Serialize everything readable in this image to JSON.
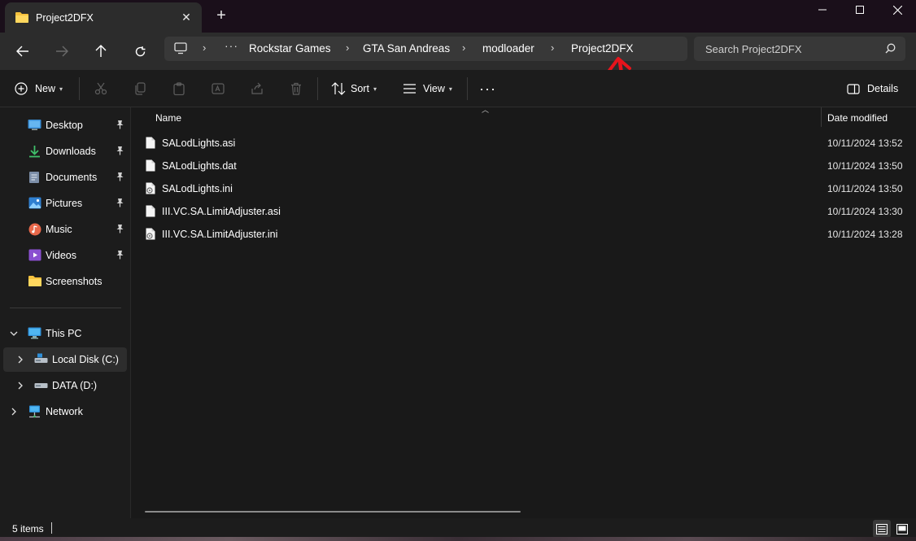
{
  "window": {
    "tab_title": "Project2DFX",
    "new_tab_symbol": "+"
  },
  "address": {
    "breadcrumbs": [
      "Rockstar Games",
      "GTA San Andreas",
      "modloader",
      "Project2DFX"
    ],
    "overflow": "···",
    "search_placeholder": "Search Project2DFX"
  },
  "toolbar": {
    "new_label": "New",
    "sort_label": "Sort",
    "view_label": "View",
    "more_label": "···",
    "details_label": "Details"
  },
  "sidebar": {
    "quick_access": [
      {
        "label": "Desktop",
        "icon": "desktop-icon",
        "pinned": true
      },
      {
        "label": "Downloads",
        "icon": "download-icon",
        "pinned": true
      },
      {
        "label": "Documents",
        "icon": "document-icon",
        "pinned": true
      },
      {
        "label": "Pictures",
        "icon": "picture-icon",
        "pinned": true
      },
      {
        "label": "Music",
        "icon": "music-icon",
        "pinned": true
      },
      {
        "label": "Videos",
        "icon": "video-icon",
        "pinned": true
      },
      {
        "label": "Screenshots",
        "icon": "folder-icon",
        "pinned": false
      }
    ],
    "this_pc": "This PC",
    "drives": [
      {
        "label": "Local Disk (C:)",
        "selected": true
      },
      {
        "label": "DATA (D:)",
        "selected": false
      }
    ],
    "network": "Network"
  },
  "files": {
    "columns": {
      "name": "Name",
      "date": "Date modified"
    },
    "rows": [
      {
        "name": "SALodLights.asi",
        "date": "10/11/2024 13:52",
        "type": "file"
      },
      {
        "name": "SALodLights.dat",
        "date": "10/11/2024 13:50",
        "type": "file"
      },
      {
        "name": "SALodLights.ini",
        "date": "10/11/2024 13:50",
        "type": "settings"
      },
      {
        "name": "III.VC.SA.LimitAdjuster.asi",
        "date": "10/11/2024 13:30",
        "type": "file"
      },
      {
        "name": "III.VC.SA.LimitAdjuster.ini",
        "date": "10/11/2024 13:28",
        "type": "settings"
      }
    ]
  },
  "status": {
    "item_count": "5 items"
  },
  "colors": {
    "folder": "#f5c13e",
    "accent_arrow": "#e8141c",
    "background": "#191919"
  }
}
